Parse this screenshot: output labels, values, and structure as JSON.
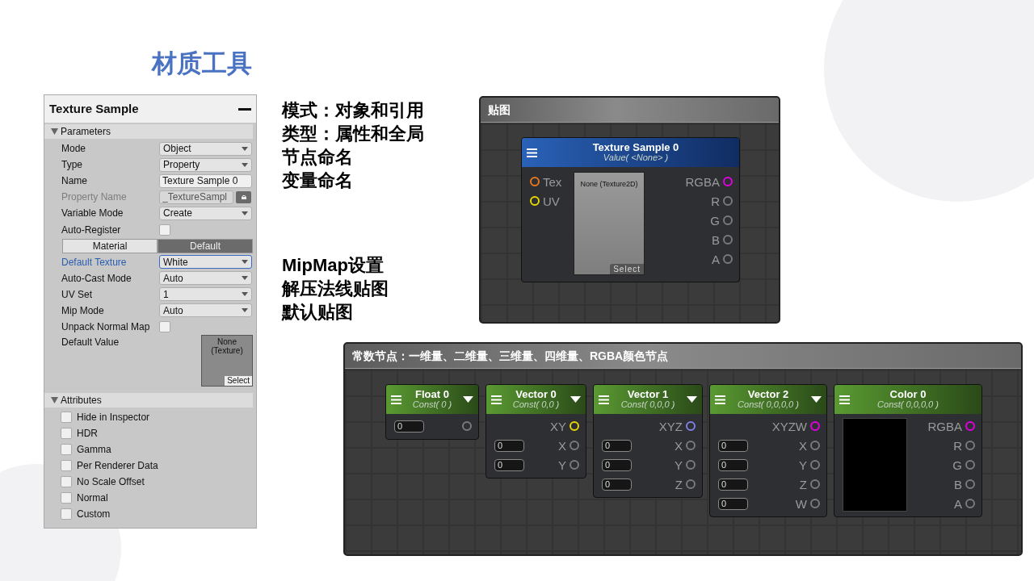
{
  "slide_title": "材质工具",
  "inspector": {
    "title": "Texture Sample",
    "sections": [
      {
        "label": "Parameters",
        "expanded": true,
        "fields": [
          {
            "kind": "dropdown",
            "label": "Mode",
            "value": "Object",
            "disabled": false,
            "highlighted": false
          },
          {
            "kind": "dropdown",
            "label": "Type",
            "value": "Property",
            "disabled": false,
            "highlighted": false
          },
          {
            "kind": "text",
            "label": "Name",
            "value": "Texture Sample 0",
            "disabled": false,
            "highlighted": false
          },
          {
            "kind": "locked_text",
            "label": "Property Name",
            "value": "_TextureSampl",
            "disabled": true,
            "highlighted": false
          },
          {
            "kind": "dropdown",
            "label": "Variable Mode",
            "value": "Create",
            "disabled": false,
            "highlighted": false
          },
          {
            "kind": "checkbox",
            "label": "Auto-Register",
            "checked": false,
            "disabled": false,
            "highlighted": false
          },
          {
            "kind": "toggle",
            "options": [
              {
                "label": "Material",
                "selected": false
              },
              {
                "label": "Default",
                "selected": true
              }
            ]
          },
          {
            "kind": "dropdown",
            "label": "Default Texture",
            "value": "White",
            "disabled": false,
            "highlighted": true
          },
          {
            "kind": "dropdown",
            "label": "Auto-Cast Mode",
            "value": "Auto",
            "disabled": false,
            "highlighted": false
          },
          {
            "kind": "dropdown",
            "label": "UV Set",
            "value": "1",
            "disabled": false,
            "highlighted": false
          },
          {
            "kind": "dropdown",
            "label": "Mip Mode",
            "value": "Auto",
            "disabled": false,
            "highlighted": false
          },
          {
            "kind": "checkbox",
            "label": "Unpack Normal Map",
            "checked": false,
            "disabled": false,
            "highlighted": false
          },
          {
            "kind": "texture",
            "label": "Default Value",
            "value": "None\n(Texture)",
            "button": "Select",
            "disabled": false,
            "highlighted": false
          }
        ]
      },
      {
        "label": "Attributes",
        "expanded": true,
        "fields": [
          {
            "kind": "attr",
            "label": "Hide in Inspector",
            "checked": false
          },
          {
            "kind": "attr",
            "label": "HDR",
            "checked": false
          },
          {
            "kind": "attr",
            "label": "Gamma",
            "checked": false
          },
          {
            "kind": "attr",
            "label": "Per Renderer Data",
            "checked": false
          },
          {
            "kind": "attr",
            "label": "No Scale Offset",
            "checked": false
          },
          {
            "kind": "attr",
            "label": "Normal",
            "checked": false
          },
          {
            "kind": "attr",
            "label": "Custom",
            "checked": false
          }
        ]
      }
    ]
  },
  "notes": [
    [
      "模式：对象和引用",
      "类型：属性和全局",
      "节点命名",
      "变量命名"
    ],
    [
      "MipMap设置",
      "解压法线贴图",
      "默认贴图"
    ]
  ],
  "texture_panel": {
    "title": "贴图",
    "node": {
      "title": "Texture Sample 0",
      "subtitle": "Value( <None> )",
      "inputs": [
        {
          "label": "Tex",
          "color": "#e8781e"
        },
        {
          "label": "UV",
          "color": "#e6d800"
        }
      ],
      "preview_label": "None (Texture2D)",
      "button": "Select",
      "outputs": [
        {
          "label": "RGBA",
          "color": "#e000e0"
        },
        {
          "label": "R",
          "color": "#7a7a7a"
        },
        {
          "label": "G",
          "color": "#7a7a7a"
        },
        {
          "label": "B",
          "color": "#7a7a7a"
        },
        {
          "label": "A",
          "color": "#7a7a7a"
        }
      ]
    }
  },
  "constants_panel": {
    "title": "常数节点：一维量、二维量、三维量、四维量、RGBA颜色节点",
    "nodes": [
      {
        "kind": "vector",
        "title": "Float 0",
        "subtitle": "Const( 0 )",
        "menu": true,
        "rows": [
          {
            "field": "0",
            "color": "#7a7a7a"
          }
        ]
      },
      {
        "kind": "vector",
        "title": "Vector 0",
        "subtitle": "Const( 0,0 )",
        "menu": true,
        "rows": [
          {
            "label": "XY",
            "color": "#e6d800"
          },
          {
            "field": "0",
            "label": "X",
            "color": "#7a7a7a"
          },
          {
            "field": "0",
            "label": "Y",
            "color": "#7a7a7a"
          }
        ]
      },
      {
        "kind": "vector",
        "title": "Vector 1",
        "subtitle": "Const( 0,0,0 )",
        "menu": true,
        "rows": [
          {
            "label": "XYZ",
            "color": "#7f7fe6"
          },
          {
            "field": "0",
            "label": "X",
            "color": "#7a7a7a"
          },
          {
            "field": "0",
            "label": "Y",
            "color": "#7a7a7a"
          },
          {
            "field": "0",
            "label": "Z",
            "color": "#7a7a7a"
          }
        ]
      },
      {
        "kind": "vector",
        "title": "Vector 2",
        "subtitle": "Const( 0,0,0,0 )",
        "menu": true,
        "rows": [
          {
            "label": "XYZW",
            "color": "#e000e0"
          },
          {
            "field": "0",
            "label": "X",
            "color": "#7a7a7a"
          },
          {
            "field": "0",
            "label": "Y",
            "color": "#7a7a7a"
          },
          {
            "field": "0",
            "label": "Z",
            "color": "#7a7a7a"
          },
          {
            "field": "0",
            "label": "W",
            "color": "#7a7a7a"
          }
        ]
      },
      {
        "kind": "color",
        "title": "Color 0",
        "subtitle": "Const( 0,0,0,0 )",
        "menu": false,
        "rows": [
          {
            "label": "RGBA",
            "color": "#e000e0"
          },
          {
            "label": "R",
            "color": "#7a7a7a"
          },
          {
            "label": "G",
            "color": "#7a7a7a"
          },
          {
            "label": "B",
            "color": "#7a7a7a"
          },
          {
            "label": "A",
            "color": "#7a7a7a"
          }
        ]
      }
    ]
  }
}
